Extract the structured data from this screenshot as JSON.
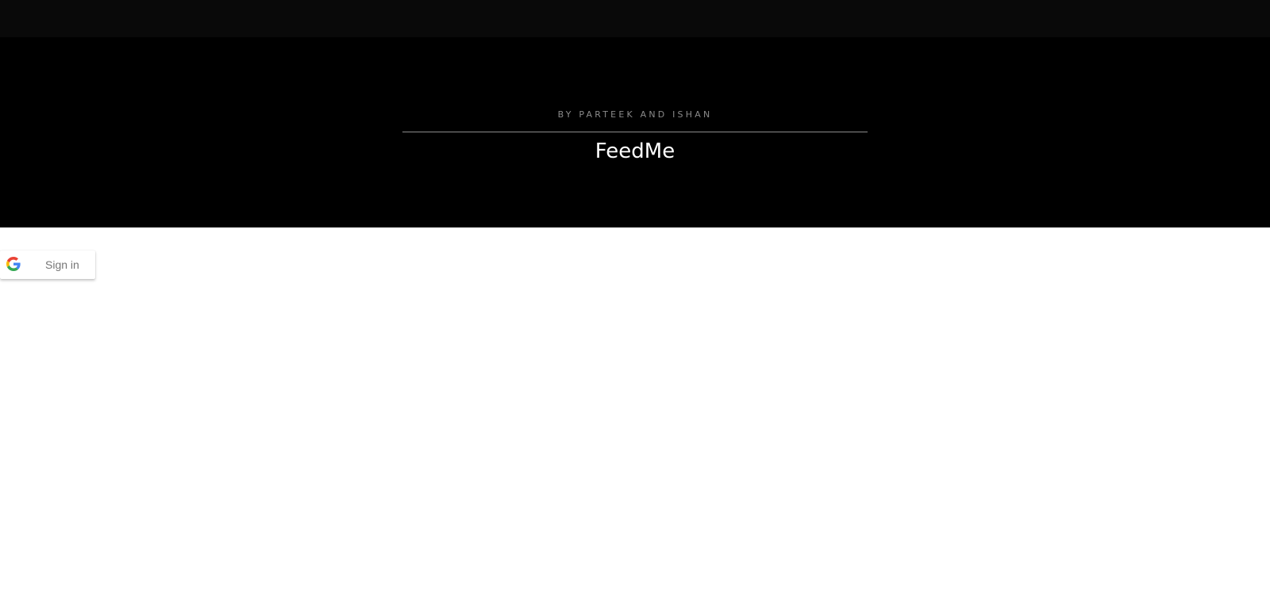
{
  "header": {
    "byline": "BY PARTEEK AND ISHAN",
    "title": "FeedMe"
  },
  "signin": {
    "label": "Sign in",
    "icon": "google-g-icon"
  },
  "colors": {
    "topbar": "#090909",
    "hero_background": "#000000",
    "byline": "#8a8a8a",
    "title": "#ffffff",
    "button_text": "#757575"
  }
}
